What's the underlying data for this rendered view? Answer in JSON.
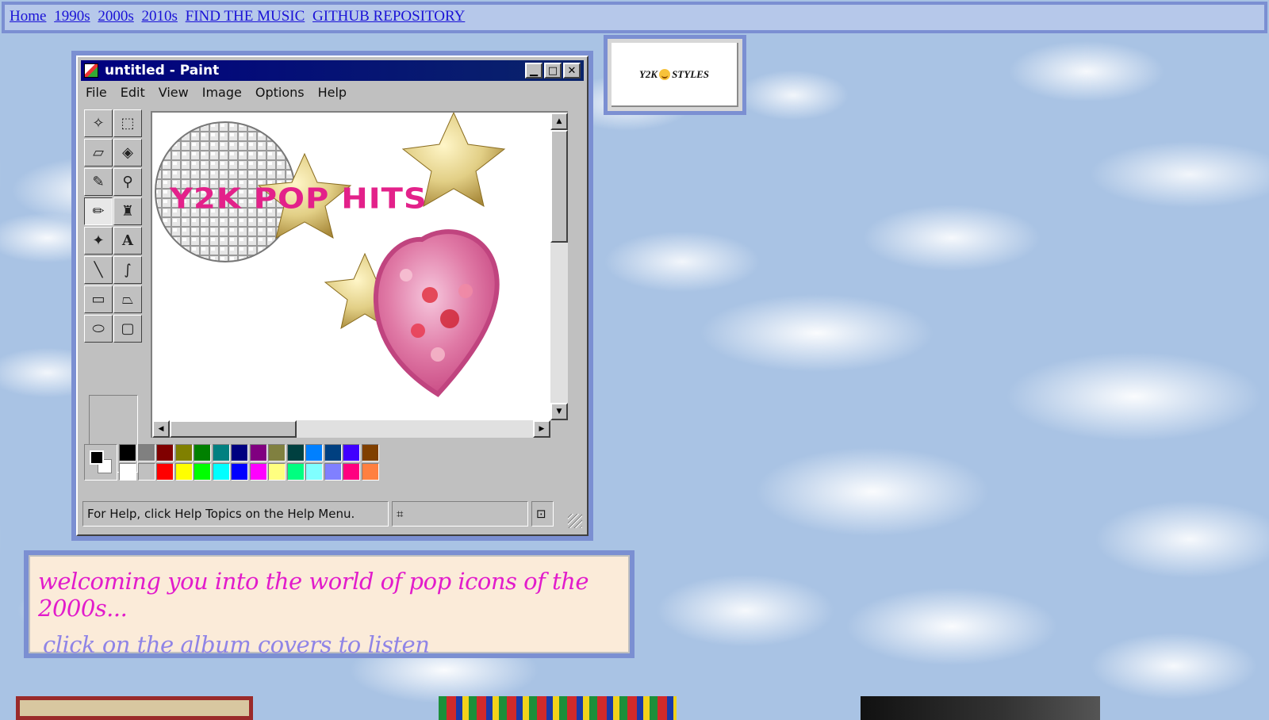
{
  "nav": {
    "links": [
      "Home",
      "1990s",
      "2000s",
      "2010s",
      "FIND THE MUSIC",
      "GITHUB REPOSITORY"
    ]
  },
  "badge": {
    "prefix": "Y2K",
    "suffix": "STYLES"
  },
  "paint": {
    "title": "untitled - Paint",
    "menu": [
      "File",
      "Edit",
      "View",
      "Image",
      "Options",
      "Help"
    ],
    "canvas_text": "Y2K POP HITS",
    "status": "For Help, click Help Topics on the Help Menu.",
    "palette_row1": [
      "#000000",
      "#808080",
      "#800000",
      "#808000",
      "#008000",
      "#008080",
      "#000080",
      "#800080",
      "#808040",
      "#004040",
      "#0080ff",
      "#004080",
      "#4000ff",
      "#804000"
    ],
    "palette_row2": [
      "#ffffff",
      "#c0c0c0",
      "#ff0000",
      "#ffff00",
      "#00ff00",
      "#00ffff",
      "#0000ff",
      "#ff00ff",
      "#ffff80",
      "#00ff80",
      "#80ffff",
      "#8080ff",
      "#ff0080",
      "#ff8040"
    ]
  },
  "welcome": {
    "line1": "welcoming you into the world of pop icons of the 2000s...",
    "line2": "click on the album covers to listen"
  },
  "colors": {
    "frame": "#7b8fd2",
    "link": "#1a12d6",
    "headline": "#e3218a",
    "welcome_line1": "#e21bcb",
    "welcome_line2": "#8f84e6"
  }
}
